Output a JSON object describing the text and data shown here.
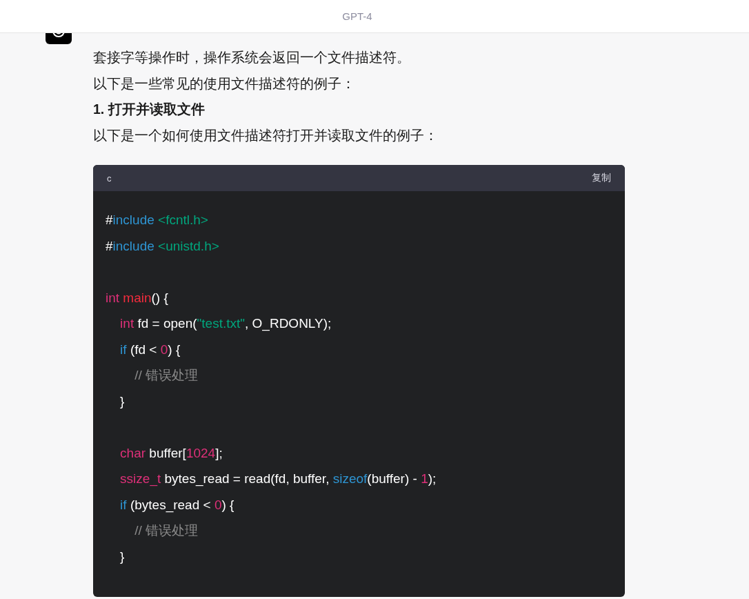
{
  "header": {
    "title": "GPT-4"
  },
  "message": {
    "paragraphs": [
      {
        "kind": "text",
        "text": "套接字等操作时，操作系统会返回一个文件描述符。"
      },
      {
        "kind": "text",
        "text": "以下是一些常见的使用文件描述符的例子："
      },
      {
        "kind": "heading",
        "text": "1. 打开并读取文件"
      },
      {
        "kind": "text",
        "text": "以下是一个如何使用文件描述符打开并读取文件的例子："
      }
    ],
    "code": {
      "language": "c",
      "copy_label": "复制",
      "lines": [
        {
          "kind": "code",
          "tokens": [
            {
              "kind": "plain",
              "text": "#"
            },
            {
              "kind": "keyword",
              "text": "include"
            },
            {
              "kind": "string",
              "text": " <fcntl.h>"
            }
          ]
        },
        {
          "kind": "code",
          "tokens": [
            {
              "kind": "plain",
              "text": "#"
            },
            {
              "kind": "keyword",
              "text": "include"
            },
            {
              "kind": "string",
              "text": " <unistd.h>"
            }
          ]
        },
        {
          "kind": "blank"
        },
        {
          "kind": "code",
          "tokens": [
            {
              "kind": "type",
              "text": "int"
            },
            {
              "kind": "function",
              "text": " main"
            },
            {
              "kind": "plain",
              "text": "() {"
            }
          ]
        },
        {
          "kind": "code",
          "tokens": [
            {
              "kind": "type",
              "text": "    int"
            },
            {
              "kind": "plain",
              "text": " fd = open("
            },
            {
              "kind": "string",
              "text": "\"test.txt\""
            },
            {
              "kind": "plain",
              "text": ", O_RDONLY);"
            }
          ]
        },
        {
          "kind": "code",
          "tokens": [
            {
              "kind": "keyword",
              "text": "    if"
            },
            {
              "kind": "plain",
              "text": " (fd < "
            },
            {
              "kind": "number",
              "text": "0"
            },
            {
              "kind": "plain",
              "text": ") {"
            }
          ]
        },
        {
          "kind": "code",
          "tokens": [
            {
              "kind": "comment",
              "text": "        // 错误处理"
            }
          ]
        },
        {
          "kind": "code",
          "tokens": [
            {
              "kind": "plain",
              "text": "    }"
            }
          ]
        },
        {
          "kind": "blank"
        },
        {
          "kind": "code",
          "tokens": [
            {
              "kind": "type",
              "text": "    char"
            },
            {
              "kind": "plain",
              "text": " buffer["
            },
            {
              "kind": "number",
              "text": "1024"
            },
            {
              "kind": "plain",
              "text": "];"
            }
          ]
        },
        {
          "kind": "code",
          "tokens": [
            {
              "kind": "type",
              "text": "    ssize_t"
            },
            {
              "kind": "plain",
              "text": " bytes_read = read(fd, buffer, "
            },
            {
              "kind": "keyword",
              "text": "sizeof"
            },
            {
              "kind": "plain",
              "text": "(buffer) - "
            },
            {
              "kind": "number",
              "text": "1"
            },
            {
              "kind": "plain",
              "text": ");"
            }
          ]
        },
        {
          "kind": "code",
          "tokens": [
            {
              "kind": "keyword",
              "text": "    if"
            },
            {
              "kind": "plain",
              "text": " (bytes_read < "
            },
            {
              "kind": "number",
              "text": "0"
            },
            {
              "kind": "plain",
              "text": ") {"
            }
          ]
        },
        {
          "kind": "code",
          "tokens": [
            {
              "kind": "comment",
              "text": "        // 错误处理"
            }
          ]
        },
        {
          "kind": "code",
          "tokens": [
            {
              "kind": "plain",
              "text": "    }"
            }
          ]
        }
      ]
    }
  }
}
